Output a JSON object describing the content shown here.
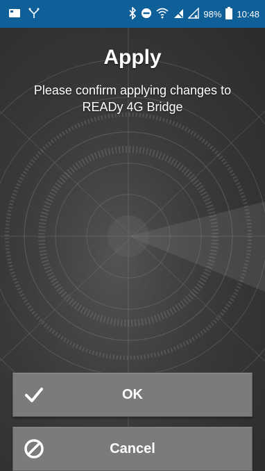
{
  "status_bar": {
    "left_icons": [
      "sd-card-icon",
      "usb-debug-icon"
    ],
    "right_icons": [
      "bluetooth-icon",
      "do-not-disturb-icon",
      "wifi-icon",
      "no-sim-icon",
      "signal-icon"
    ],
    "battery": "98%",
    "time": "10:48"
  },
  "dialog": {
    "title": "Apply",
    "message": "Please confirm applying changes to READy 4G Bridge"
  },
  "buttons": {
    "ok": {
      "label": "OK",
      "icon": "checkmark-icon"
    },
    "cancel": {
      "label": "Cancel",
      "icon": "prohibited-icon"
    }
  },
  "colors": {
    "status_bar": "#0f5f98",
    "button": "#7b7b7b",
    "text": "#ffffff"
  }
}
